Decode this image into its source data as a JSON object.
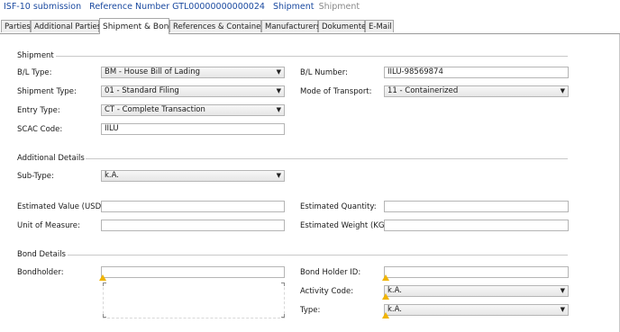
{
  "breadcrumb": {
    "isf": "ISF-10 submission",
    "reference": "Reference Number GTL00000000000024",
    "shipment": "Shipment",
    "current": "Shipment"
  },
  "tabs": [
    {
      "label": "Parties"
    },
    {
      "label": "Additional Parties"
    },
    {
      "label": "Shipment & Bond",
      "active": true
    },
    {
      "label": "References & Containers"
    },
    {
      "label": "Manufacturers"
    },
    {
      "label": "Dokumente"
    },
    {
      "label": "E-Mail"
    }
  ],
  "shipment": {
    "title": "Shipment",
    "bl_type_label": "B/L Type:",
    "bl_type_value": "BM - House Bill of Lading",
    "bl_number_label": "B/L Number:",
    "bl_number_value": "IILU-98569874",
    "shipment_type_label": "Shipment Type:",
    "shipment_type_value": "01 - Standard Filing",
    "mode_label": "Mode of Transport:",
    "mode_value": "11 - Containerized",
    "entry_type_label": "Entry Type:",
    "entry_type_value": "CT - Complete Transaction",
    "scac_label": "SCAC Code:",
    "scac_value": "IILU"
  },
  "additional": {
    "title": "Additional Details",
    "subtype_label": "Sub-Type:",
    "subtype_value": "k.A.",
    "est_value_label": "Estimated Value (USD):",
    "est_value_value": "",
    "est_quantity_label": "Estimated Quantity:",
    "est_quantity_value": "",
    "uom_label": "Unit of Measure:",
    "uom_value": "",
    "est_weight_label": "Estimated Weight (KG):",
    "est_weight_value": ""
  },
  "bond": {
    "title": "Bond Details",
    "bondholder_label": "Bondholder:",
    "bondholder_value": "",
    "bondholder_id_label": "Bond Holder ID:",
    "bondholder_id_value": "",
    "activity_label": "Activity Code:",
    "activity_value": "k.A.",
    "type_label": "Type:",
    "type_value": "k.A."
  },
  "colors": {
    "link": "#1b4aa0",
    "warning": "#f0b400"
  }
}
